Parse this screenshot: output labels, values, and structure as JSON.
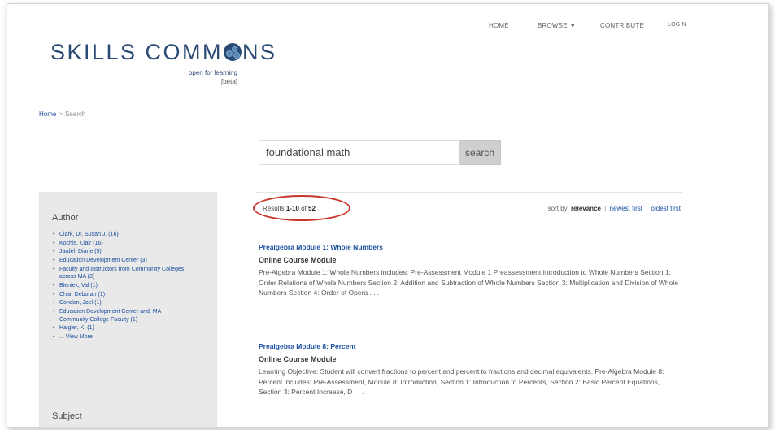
{
  "nav": {
    "home": "HOME",
    "browse": "BROWSE",
    "contribute": "CONTRIBUTE",
    "login": "LOGIN"
  },
  "logo": {
    "text_left": "SKILLS COMM",
    "text_right": "NS",
    "tagline": "open for learning",
    "beta": "[beta]",
    "color": "#2b4a73"
  },
  "breadcrumb": {
    "home": "Home",
    "separator": ">",
    "current": "Search"
  },
  "search": {
    "value": "foundational math",
    "button_label": "search"
  },
  "results_header": {
    "prefix": "Results ",
    "range": "1-10",
    "of_text": " of ",
    "total": "52",
    "sort_label": "sort by: ",
    "sort_active": "relevance",
    "sort_newest": "newest first",
    "sort_oldest": "oldest first",
    "separator": "|"
  },
  "facets": {
    "author": {
      "title": "Author",
      "items": [
        "Clark, Dr. Susan J. (16)",
        "Kochis, Clair (16)",
        "Jardel, Diane (5)",
        "Education Development Center (3)",
        "Faculty and Instructors from Community Colleges across MA (3)",
        "Bieniek, Val (1)",
        "Char, Deborah (1)",
        "Condon, Joel (1)",
        "Education Development Center and, MA Community College Faculty (1)",
        "Haigler, K. (1)",
        "... View More"
      ]
    },
    "subject": {
      "title": "Subject"
    }
  },
  "results": [
    {
      "title": "Prealgebra Module 1: Whole Numbers",
      "type": "Online Course Module",
      "description": "Pre-Algebra Module 1: Whole Numbers includes: Pre-Assessment Module 1 Preassessment Introduction to Whole Numbers Section 1: Order Relations of Whole Numbers Section 2: Addition and Subtraction of Whole Numbers Section 3: Multiplication and Division of Whole Numbers Section 4: Order of Opera . . ."
    },
    {
      "title": "Prealgebra Module 8: Percent",
      "type": "Online Course Module",
      "description": "Learning Objective: Student will convert fractions to percent and percent to fractions and decimal equivalents. Pre-Algebra Module 8: Percent includes: Pre-Assessment, Module 8: Introduction, Section 1: Introduction to Percents, Section 2: Basic Percent Equations, Section 3: Percent Increase, D . . ."
    }
  ],
  "colors": {
    "link": "#1a4fa0",
    "highlight": "#c8362a",
    "sidebar_bg": "#e9e9e9"
  }
}
